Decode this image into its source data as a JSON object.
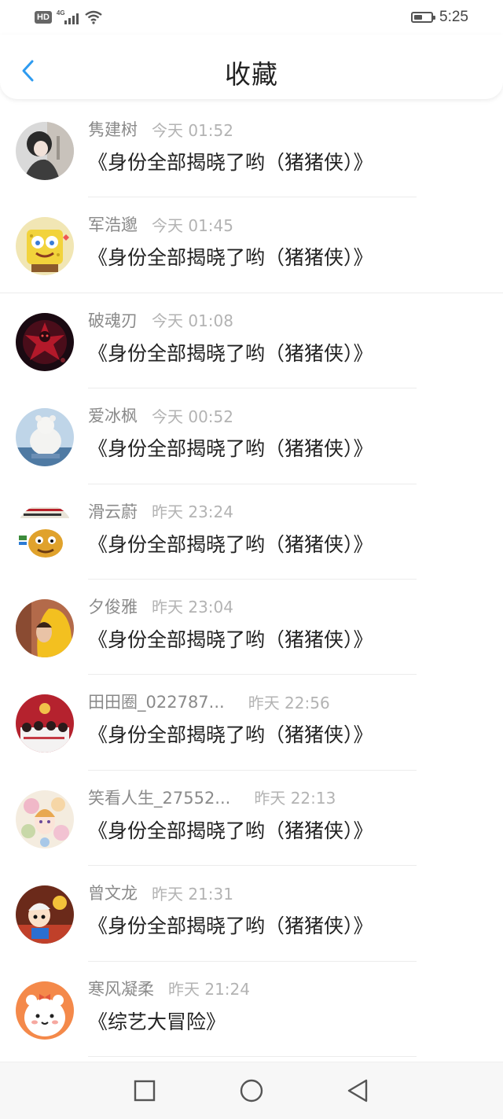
{
  "status_bar": {
    "hd": "HD",
    "network": "4G",
    "time": "5:25",
    "battery_level": 0.5
  },
  "header": {
    "title": "收藏",
    "back_icon": "chevron-left-icon",
    "accent_color": "#2e9bf0"
  },
  "items": [
    {
      "username": "隽建树",
      "time": "今天 01:52",
      "content": "《身份全部揭晓了哟（猪猪侠）》",
      "avatar": "avatar-photo-girl"
    },
    {
      "username": "军浩邈",
      "time": "今天 01:45",
      "content": "《身份全部揭晓了哟（猪猪侠）》",
      "avatar": "avatar-spongebob"
    },
    {
      "username": "破魂刃",
      "time": "今天 01:08",
      "content": "《身份全部揭晓了哟（猪猪侠）》",
      "avatar": "avatar-dark-red-figure"
    },
    {
      "username": "爱冰枫",
      "time": "今天 00:52",
      "content": "《身份全部揭晓了哟（猪猪侠）》",
      "avatar": "avatar-white-bear"
    },
    {
      "username": "滑云蔚",
      "time": "昨天 23:24",
      "content": "《身份全部揭晓了哟（猪猪侠）》",
      "avatar": "avatar-cartoon-poster"
    },
    {
      "username": "夕俊雅",
      "time": "昨天 23:04",
      "content": "《身份全部揭晓了哟（猪猪侠）》",
      "avatar": "avatar-yellow-hood"
    },
    {
      "username": "田田圈_022787...",
      "time": "昨天 22:56",
      "content": "《身份全部揭晓了哟（猪猪侠）》",
      "avatar": "avatar-red-group"
    },
    {
      "username": "笑看人生_27552...",
      "time": "昨天 22:13",
      "content": "《身份全部揭晓了哟（猪猪侠）》",
      "avatar": "avatar-anime-floral"
    },
    {
      "username": "曾文龙",
      "time": "昨天 21:31",
      "content": "《身份全部揭晓了哟（猪猪侠）》",
      "avatar": "avatar-cartoon-boy"
    },
    {
      "username": "寒风凝柔",
      "time": "昨天 21:24",
      "content": "《综艺大冒险》",
      "avatar": "avatar-cute-bear"
    }
  ],
  "nav_bar": {
    "recent_icon": "square-icon",
    "home_icon": "circle-icon",
    "back_icon": "triangle-back-icon"
  }
}
